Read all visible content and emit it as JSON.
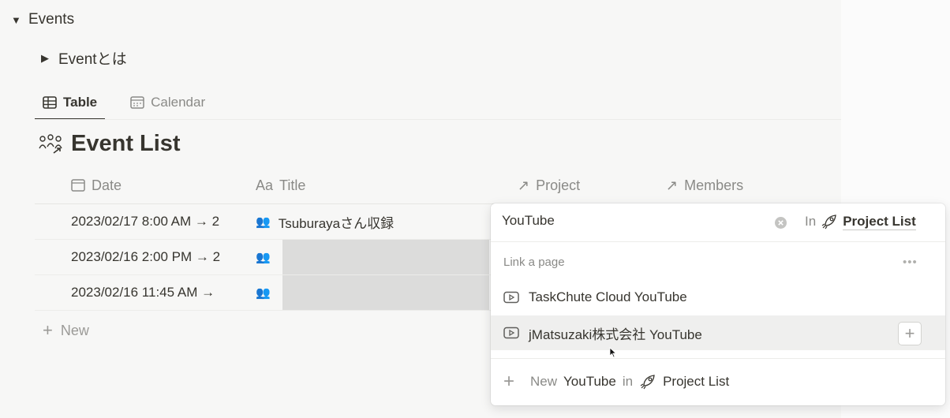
{
  "toggles": {
    "events": {
      "arrow": "▼",
      "label": "Events"
    },
    "event_toha": {
      "arrow": "▶",
      "label": "Eventとは"
    }
  },
  "tabs": [
    {
      "label": "Table",
      "icon": "table-icon",
      "active": true
    },
    {
      "label": "Calendar",
      "icon": "calendar-icon",
      "active": false
    }
  ],
  "database": {
    "title": "Event List",
    "icon": "people-link-icon"
  },
  "columns": {
    "date": {
      "icon": "calendar-icon",
      "label": "Date"
    },
    "title": {
      "icon_text": "Aa",
      "label": "Title"
    },
    "project": {
      "icon_text": "↗",
      "label": "Project"
    },
    "members": {
      "icon_text": "↗",
      "label": "Members"
    }
  },
  "rows": [
    {
      "date": "2023/02/17 8:00 AM → 2",
      "title": "Tsuburayaさん収録"
    },
    {
      "date": "2023/02/16 2:00 PM → 2",
      "title": ""
    },
    {
      "date": "2023/02/16 11:45 AM →",
      "title": ""
    }
  ],
  "new_label": "New",
  "popup": {
    "search_value": "YouTube",
    "in_label": "In",
    "scope_name": "Project List",
    "section_label": "Link a page",
    "more": "•••",
    "options": [
      {
        "label": "TaskChute Cloud YouTube",
        "icon": "video-page-icon"
      },
      {
        "label": "jMatsuzaki株式会社 YouTube",
        "icon": "video-page-icon"
      }
    ],
    "plus": "+",
    "new_prefix": "New",
    "new_name": "YouTube",
    "new_in": "in",
    "new_scope": "Project List"
  },
  "colors": {
    "text": "#37352f",
    "muted": "#8a8a87",
    "highlight": "#efefee"
  }
}
